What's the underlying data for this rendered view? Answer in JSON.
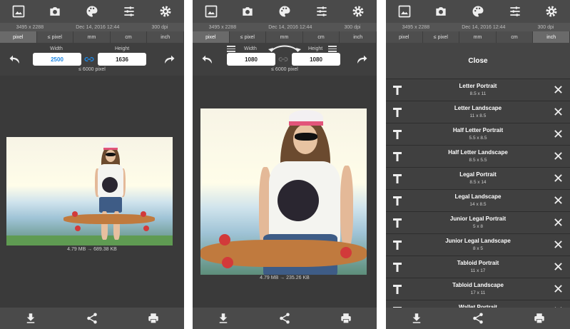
{
  "colors": {
    "topbar": "#4a4a4a",
    "accent": "#1e88e5",
    "background": "#3a3a3a"
  },
  "info": {
    "resolution": "3495 x 2288",
    "date": "Dec 14, 2016 12:44",
    "dpi": "300 dpi"
  },
  "units": [
    "pixel",
    "≤ pixel",
    "mm",
    "cm",
    "inch"
  ],
  "screen1": {
    "width_label": "Width",
    "height_label": "Height",
    "width_value": "2500",
    "height_value": "1636",
    "limit": "≤ 6000 pixel",
    "size_info": "4.79 MB → 689.38 KB"
  },
  "screen2": {
    "width_label": "Width",
    "height_label": "Height",
    "width_value": "1080",
    "height_value": "1080",
    "limit": "≤ 6000 pixel",
    "size_info": "4.79 MB → 235.26 KB"
  },
  "screen3": {
    "close_label": "Close",
    "presets": [
      {
        "name": "Letter Portrait",
        "dims": "8.5 x 11"
      },
      {
        "name": "Letter Landscape",
        "dims": "11 x 8.5"
      },
      {
        "name": "Half Letter Portrait",
        "dims": "5.5 x 8.5"
      },
      {
        "name": "Half Letter Landscape",
        "dims": "8.5 x 5.5"
      },
      {
        "name": "Legal Portrait",
        "dims": "8.5 x 14"
      },
      {
        "name": "Legal Landscape",
        "dims": "14 x 8.5"
      },
      {
        "name": "Junior Legal Portrait",
        "dims": "5 x 8"
      },
      {
        "name": "Junior Legal Landscape",
        "dims": "8 x 5"
      },
      {
        "name": "Tabloid Portrait",
        "dims": "11 x 17"
      },
      {
        "name": "Tabloid Landscape",
        "dims": "17 x 11"
      },
      {
        "name": "Wallet Portrait",
        "dims": ""
      }
    ]
  },
  "icons": {
    "top": [
      "gallery-icon",
      "camera-icon",
      "palette-icon",
      "sliders-icon",
      "gear-icon"
    ],
    "bottom": [
      "download-icon",
      "share-icon",
      "print-icon"
    ]
  }
}
